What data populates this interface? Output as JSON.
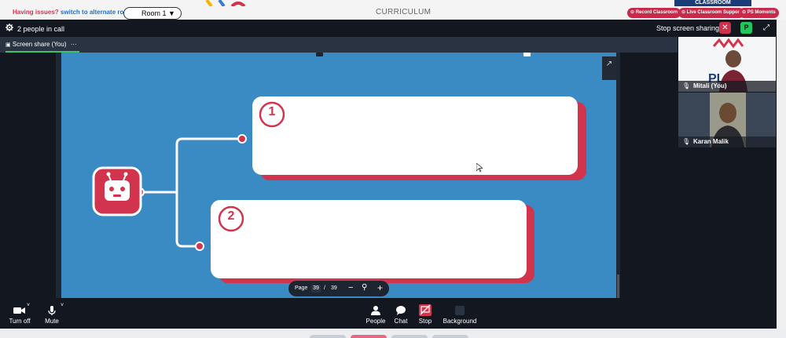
{
  "topbar": {
    "issue_prefix": "Having issues?",
    "issue_link": "switch to alternate room",
    "room_select": "Room 1",
    "page_title": "CURRICULUM",
    "buttons": [
      "Record Classroom",
      "Live Classroom Support",
      "PS Moments"
    ],
    "classroom_banner": "CLASSROOM"
  },
  "meeting": {
    "people_count": "2 people in call",
    "stop_sharing": "Stop screen sharing",
    "participant_badge": "P",
    "share_tab": "Screen share (You)",
    "share_tab_more": "···"
  },
  "slide": {
    "item1_number": "1",
    "item2_number": "2"
  },
  "pager": {
    "label": "Page",
    "current": "39",
    "separator": "/",
    "total": "39",
    "zoom_out": "−",
    "zoom_in": "+"
  },
  "participants": [
    {
      "name": "Mitali (You)"
    },
    {
      "name": "Karan Malik"
    }
  ],
  "controls": {
    "camera": "Turn off",
    "mic": "Mute",
    "people": "People",
    "chat": "Chat",
    "stop": "Stop",
    "background": "Background"
  },
  "colors": {
    "accent_red": "#d3344d",
    "slide_blue": "#3a8ac4",
    "dark_bg": "#131820",
    "green": "#22c55e"
  }
}
